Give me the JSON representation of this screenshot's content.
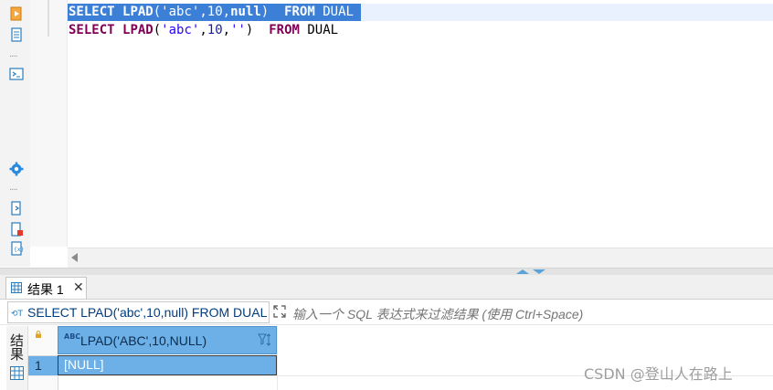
{
  "editor": {
    "line1": [
      "SELECT",
      " ",
      "LPAD",
      "(",
      "'abc'",
      ",",
      "10",
      ",",
      "null",
      ")",
      "  ",
      "FROM",
      " ",
      "DUAL"
    ],
    "line2": [
      "SELECT",
      " ",
      "LPAD",
      "(",
      "'abc'",
      ",",
      "10",
      ",",
      "''",
      ")",
      "  ",
      "FROM",
      " ",
      "DUAL"
    ]
  },
  "results": {
    "tab_label": "结果 1",
    "tab_close": "✕",
    "query_text": "SELECT LPAD('abc',10,null) FROM DUAL",
    "filter_placeholder": "输入一个 SQL 表达式来过滤结果 (使用 Ctrl+Space)",
    "panel_label": "结果",
    "column_type_badge": "ABC",
    "column_header": "LPAD('ABC',10,NULL)",
    "rows": [
      {
        "row_number": "1",
        "value": "[NULL]"
      }
    ]
  },
  "watermark": "CSDN @登山人在路上",
  "colors": {
    "selection": "#3c7fd6",
    "keyword": "#7f0055",
    "string": "#2a00ff",
    "header_blue": "#6db0e8"
  }
}
